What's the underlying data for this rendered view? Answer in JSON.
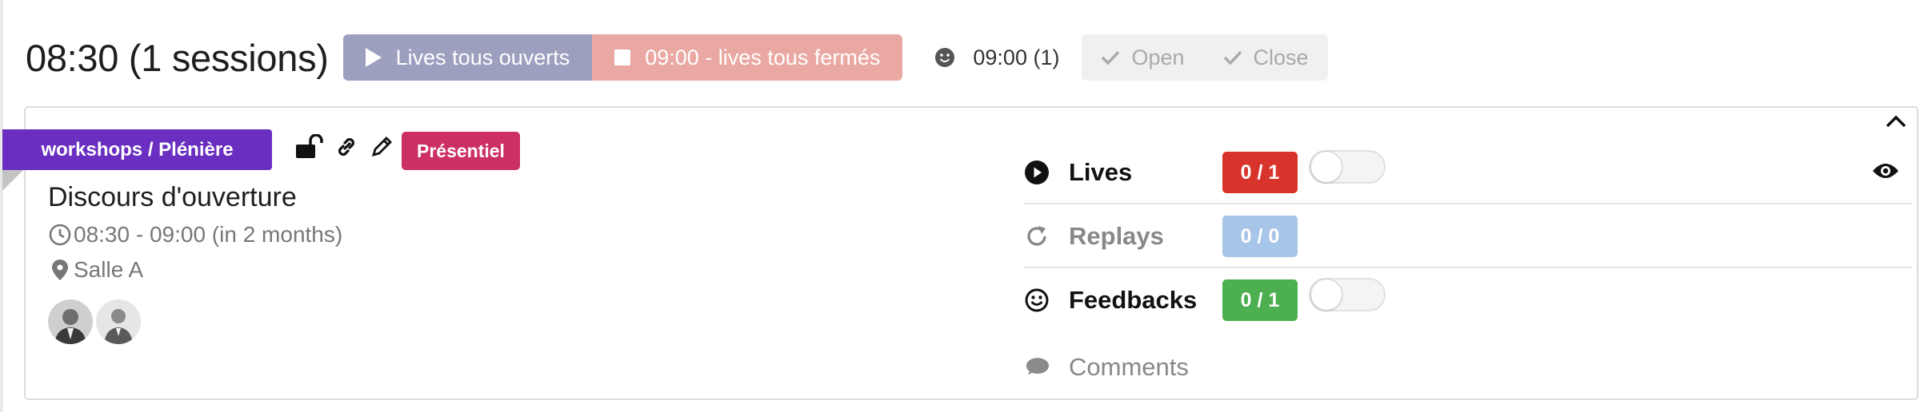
{
  "header": {
    "title": "08:30 (1 sessions)",
    "lives_open_label": "Lives tous ouverts",
    "lives_closed_label": "09:00 - lives tous fermés",
    "feedback_time": "09:00 (1)",
    "open_label": "Open",
    "close_label": "Close"
  },
  "session": {
    "track": "workshops / Plénière",
    "mode_badge": "Présentiel",
    "title": "Discours d'ouverture",
    "time": "08:30 - 09:00 (in 2 months)",
    "room": "Salle A",
    "speakers": [
      "speaker-1",
      "speaker-2"
    ]
  },
  "stats": {
    "lives": {
      "label": "Lives",
      "count": "0 / 1",
      "color": "#d9342b",
      "toggle_on": false
    },
    "replays": {
      "label": "Replays",
      "count": "0 / 0",
      "color": "#a7c5e8"
    },
    "feedbacks": {
      "label": "Feedbacks",
      "count": "0 / 1",
      "color": "#4caf50",
      "toggle_on": false
    },
    "comments": {
      "label": "Comments"
    }
  },
  "colors": {
    "lives_open_btn": "#9d9fbf",
    "lives_closed_btn": "#eaa8a3",
    "track_ribbon": "#6a2fc0",
    "presentiel_badge": "#cc2f62"
  },
  "icons": [
    "play-icon",
    "stop-icon",
    "smiley-icon",
    "check-icon",
    "chevron-up-icon",
    "unlock-icon",
    "link-icon",
    "pencil-icon",
    "clock-icon",
    "map-pin-icon",
    "replay-icon",
    "comment-icon",
    "eye-icon"
  ]
}
